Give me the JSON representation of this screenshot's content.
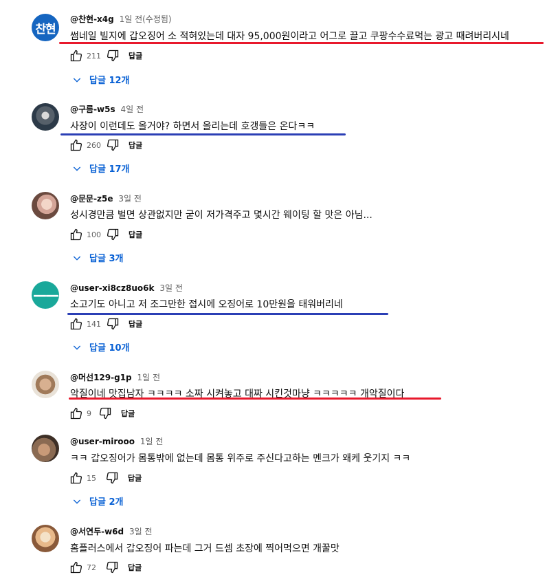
{
  "colors": {
    "red_underline": "#e8192c",
    "blue_underline": "#2b3fb5",
    "link_blue": "#065fd4"
  },
  "comments": [
    {
      "author": "@찬현-x4g",
      "time": "1일 전(수정됨)",
      "text": "썸네일 빌지에 갑오징어 소 적혀있는데 대자 95,000원이라고 어그로 끌고 쿠팡수수료먹는 광고 때려버리시네",
      "likes": "211",
      "reply_label": "답글",
      "replies": "답글 12개",
      "avatar_text": "찬현",
      "avatar_color": "#1565c0",
      "underline": "red"
    },
    {
      "author": "@구름-w5s",
      "time": "4일 전",
      "text": "사장이 이런데도 올거야? 하면서 올리는데 호갱들은 온다ㅋㅋ",
      "likes": "260",
      "reply_label": "답글",
      "replies": "답글 17개",
      "avatar_text": "",
      "avatar_color": "#4a5a6a",
      "underline": "blue"
    },
    {
      "author": "@문문-z5e",
      "time": "3일 전",
      "text": "성시경만큼 벌면 상관없지만 굳이 저가격주고 몇시간 웨이팅 할 맛은 아님...",
      "likes": "100",
      "reply_label": "답글",
      "replies": "답글 3개",
      "avatar_text": "",
      "avatar_color": "#e7c2b5",
      "underline": ""
    },
    {
      "author": "@user-xi8cz8uo6k",
      "time": "3일 전",
      "text": "소고기도 아니고 저 조그만한 접시에 오징어로 10만원을 태워버리네",
      "likes": "141",
      "reply_label": "답글",
      "replies": "답글 10개",
      "avatar_text": "——",
      "avatar_color": "#1aa89a",
      "underline": "blue"
    },
    {
      "author": "@머선129-g1p",
      "time": "1일 전",
      "text": "악질이네 맛집남자 ㅋㅋㅋㅋ 소짜 시켜놓고 대짜 시킨것마냥 ㅋㅋㅋㅋㅋ 개악질이다",
      "likes": "9",
      "reply_label": "답글",
      "replies": "",
      "avatar_text": "",
      "avatar_color": "#c9a27e",
      "underline": "red"
    },
    {
      "author": "@user-mirooo",
      "time": "1일 전",
      "text": "ㅋㅋ 갑오징어가 몸통밖에 없는데 몸통 위주로 주신다고하는 멘크가 왜케 웃기지 ㅋㅋ",
      "likes": "15",
      "reply_label": "답글",
      "replies": "답글 2개",
      "avatar_text": "",
      "avatar_color": "#8a6a52",
      "underline": ""
    },
    {
      "author": "@서연두-w6d",
      "time": "3일 전",
      "text": "홈플러스에서 갑오징어 파는데 그거 드셈 초장에 찍어먹으면 개꿀맛",
      "likes": "72",
      "reply_label": "답글",
      "replies": "",
      "avatar_text": "",
      "avatar_color": "#e8b98a",
      "underline": ""
    }
  ]
}
